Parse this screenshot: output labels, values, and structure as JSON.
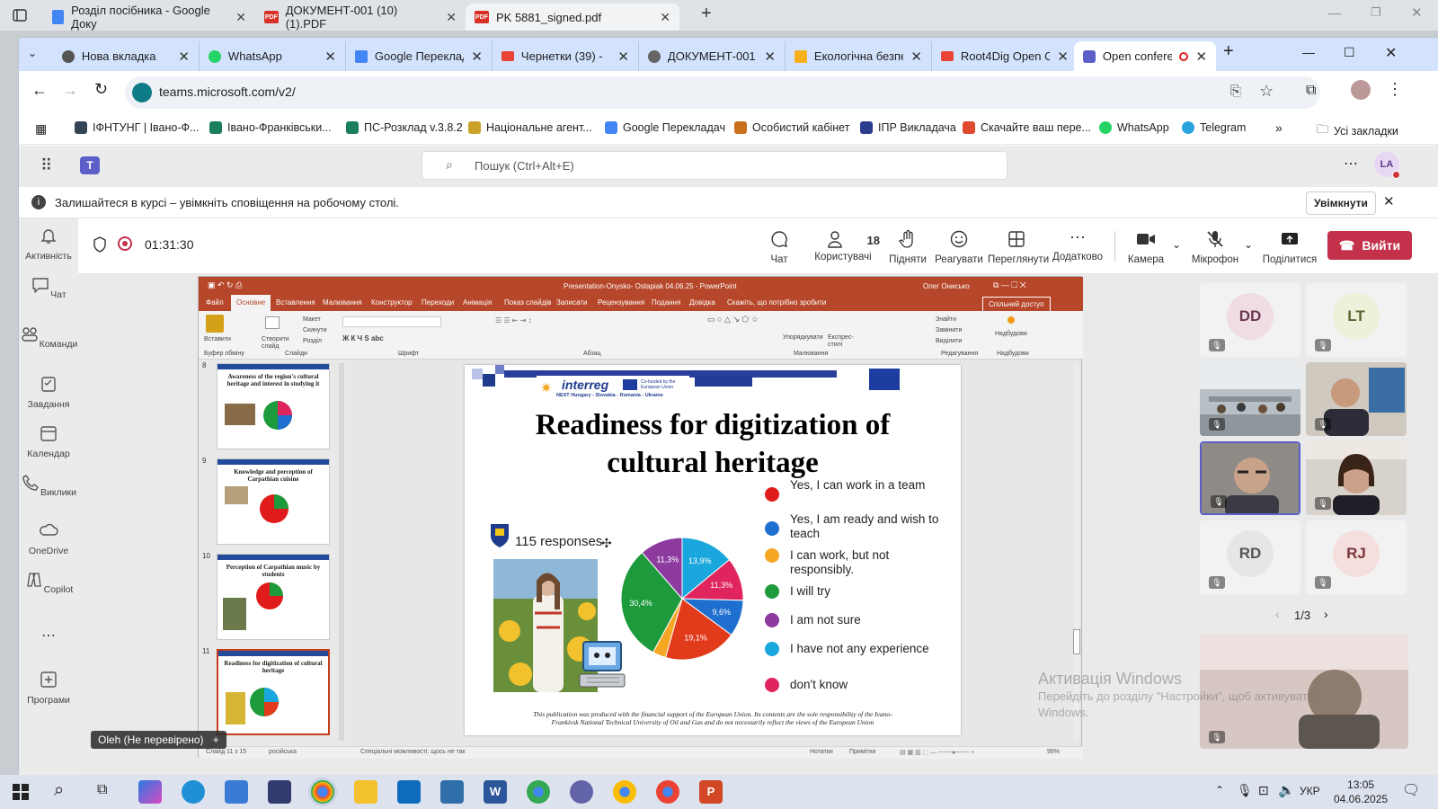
{
  "outer_tabs": [
    {
      "label": "Розділ посібника - Google Доку",
      "icon": "docs-icon"
    },
    {
      "label": "ДОКУМЕНТ-001 (10) (1).PDF",
      "icon": "pdf-icon"
    },
    {
      "label": "PK 5881_signed.pdf",
      "icon": "pdf-icon"
    }
  ],
  "inner_tabs": [
    {
      "label": "Нова вкладка"
    },
    {
      "label": "WhatsApp"
    },
    {
      "label": "Google Переклад"
    },
    {
      "label": "Чернетки (39) - "
    },
    {
      "label": "ДОКУМЕНТ-001 ("
    },
    {
      "label": "Екологічна безпе"
    },
    {
      "label": "Root4Dig Open C"
    },
    {
      "label": "Open confere"
    }
  ],
  "address": "teams.microsoft.com/v2/",
  "bookmarks": [
    "ІФНТУНГ | Івано-Ф...",
    "Івано-Франківськи...",
    "ПС-Розклад v.3.8.2",
    "Національне агент...",
    "Google Перекладач",
    "Особистий кабінет",
    "ІПР Викладача",
    "Скачайте ваш пере...",
    "WhatsApp",
    "Telegram"
  ],
  "bookmarks_all": "Усі закладки",
  "teams": {
    "search_placeholder": "Пошук (Ctrl+Alt+E)",
    "avatar_initials": "LA",
    "notification": "Залишайтеся в курсі – увімкніть сповіщення на робочому столі.",
    "notification_button": "Увімкнути",
    "rail": [
      "Активність",
      "Чат",
      "Команди",
      "Завдання",
      "Календар",
      "Виклики",
      "OneDrive",
      "Copilot",
      "Програми"
    ],
    "timer": "01:31:30",
    "toolbar": {
      "chat": "Чат",
      "people": "Користувачі",
      "people_count": "18",
      "raise": "Підняти",
      "react": "Реагувати",
      "view": "Переглянути",
      "more": "Додатково",
      "camera": "Камера",
      "mic": "Мікрофон",
      "share": "Поділитися",
      "leave": "Вийти"
    },
    "participants": [
      {
        "initials": "DD",
        "bg": "#f0dce4",
        "fg": "#6b3a4f"
      },
      {
        "initials": "LT",
        "bg": "#eef0d9",
        "fg": "#5c6230"
      },
      {
        "initials": "RD",
        "bg": "#e6e6e6",
        "fg": "#555555"
      },
      {
        "initials": "RJ",
        "bg": "#f4dede",
        "fg": "#7a3636"
      }
    ],
    "pager": "1/3",
    "presenter_label": "Oleh (Не перевірено)",
    "watermark_title": "Активація Windows",
    "watermark_sub": "Перейдіть до розділу \"Настройки\", щоб активувати Windows."
  },
  "ppt": {
    "title": "Presentation-Onysko- Ostapiak 04.06.25 - PowerPoint",
    "user": "Олег Онисько",
    "menu": [
      "Файл",
      "Основне",
      "Вставлення",
      "Малювання",
      "Конструктор",
      "Переходи",
      "Анімація",
      "Показ слайдів",
      "Записати",
      "Рецензування",
      "Подання",
      "Довідка",
      "Скажіть, що потрібно зробити"
    ],
    "share": "Спільний доступ",
    "ribbon_groups": [
      "Буфер обміну",
      "Слайди",
      "Шрифт",
      "Абзац",
      "Малювання",
      "Редагування",
      "Надбудови"
    ],
    "ribbon_buttons": [
      "Вставити",
      "Створити слайд",
      "Макет",
      "Скинути",
      "Розділ",
      "Упорядкувати",
      "Експрес-стилі",
      "Знайти",
      "Замінити",
      "Виділити",
      "Надбудови"
    ],
    "thumbs": [
      {
        "num": "8",
        "title": "Awareness of the region's cultural heritage and interest in studying it"
      },
      {
        "num": "9",
        "title": "Knowledge and perception of Carpathian cuisine"
      },
      {
        "num": "10",
        "title": "Perception of Carpathian music by students"
      },
      {
        "num": "11",
        "title": "Readiness for digitization of cultural heritage"
      }
    ],
    "status": {
      "slide": "Слайд 11 з 15",
      "lang": "російська",
      "access": "Спеціальні можливості: щось не так",
      "notes": "Нотатки",
      "comments": "Примітки",
      "zoom": "99%"
    }
  },
  "slide": {
    "logo_name": "interreg",
    "logo_sub": "NEXT Hungary - Slovakia - Romania - Ukraine",
    "cofunded": "Co-funded by the European Union",
    "title_line1": "Readiness for digitization of",
    "title_line2": "cultural heritage",
    "responses": "115 responses",
    "footer_line1": "This publication was produced with the financial support of the European Union. Its contents are the sole responsibility of the Ivano-",
    "footer_line2": "Frankivsk National Technical University of Oil and Gas and do not necessarily reflect the views of the European Union"
  },
  "chart_data": {
    "type": "pie",
    "title": "",
    "slices": [
      {
        "label": "Yes, I can work in a team",
        "value": 0,
        "color": "#e01b1b",
        "pct_text": ""
      },
      {
        "label": "Yes, I am ready and wish to teach",
        "value": 9.6,
        "color": "#1e6fd0",
        "pct_text": "9,6%"
      },
      {
        "label": "I can work, but not responsibly.",
        "value": 3.5,
        "color": "#f5a623",
        "pct_text": ""
      },
      {
        "label": "I will try",
        "value": 30.4,
        "color": "#1d9b3c",
        "pct_text": "30,4%"
      },
      {
        "label": "I am not sure",
        "value": 11.3,
        "color": "#8e3ba0",
        "pct_text": "11,3%"
      },
      {
        "label": "I have not any experience",
        "value": 13.9,
        "color": "#1aa7dd",
        "pct_text": "13,9%"
      },
      {
        "label": "don't know",
        "value": 11.3,
        "color": "#e0245e",
        "pct_text": "11,3%"
      },
      {
        "label": "",
        "value": 19.1,
        "color": "#e23b1c",
        "pct_text": "19,1%"
      }
    ]
  },
  "taskbar": {
    "time": "13:05",
    "date": "04.06.2025",
    "lang": "УКР"
  }
}
